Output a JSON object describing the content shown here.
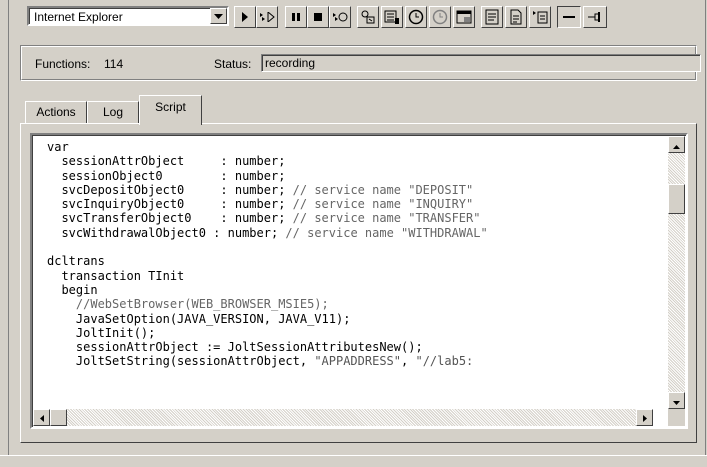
{
  "toolbar": {
    "browser_select_value": "Internet Explorer",
    "icons": [
      "play-icon",
      "step-play-icon",
      "pause-icon",
      "stop-icon",
      "record-icon",
      "wizard-icon",
      "options-icon",
      "timer-icon",
      "timer-stop-icon",
      "window-icon",
      "report-icon",
      "script-file-icon",
      "test-icon",
      "minimize-icon",
      "pin-icon"
    ]
  },
  "status": {
    "functions_label": "Functions:",
    "functions_count": "114",
    "status_label": "Status:",
    "status_value": "recording"
  },
  "tabs": [
    {
      "label": "Actions",
      "active": false
    },
    {
      "label": "Log",
      "active": false
    },
    {
      "label": "Script",
      "active": true
    }
  ],
  "script": {
    "lines": [
      [
        {
          "t": "var",
          "c": ""
        }
      ],
      [
        {
          "t": "  sessionAttrObject     : number;",
          "c": ""
        }
      ],
      [
        {
          "t": "  sessionObject0        : number;",
          "c": ""
        }
      ],
      [
        {
          "t": "  svcDepositObject0     : number; ",
          "c": ""
        },
        {
          "t": "// service name \"DEPOSIT\"",
          "c": "cm"
        }
      ],
      [
        {
          "t": "  svcInquiryObject0     : number; ",
          "c": ""
        },
        {
          "t": "// service name \"INQUIRY\"",
          "c": "cm"
        }
      ],
      [
        {
          "t": "  svcTransferObject0    : number; ",
          "c": ""
        },
        {
          "t": "// service name \"TRANSFER\"",
          "c": "cm"
        }
      ],
      [
        {
          "t": "  svcWithdrawalObject0 : number; ",
          "c": ""
        },
        {
          "t": "// service name \"WITHDRAWAL\"",
          "c": "cm"
        }
      ],
      [
        {
          "t": "",
          "c": ""
        }
      ],
      [
        {
          "t": "dcltrans",
          "c": ""
        }
      ],
      [
        {
          "t": "  transaction TInit",
          "c": ""
        }
      ],
      [
        {
          "t": "  begin",
          "c": ""
        }
      ],
      [
        {
          "t": "    //WebSetBrowser(WEB_BROWSER_MSIE5);",
          "c": "cm"
        }
      ],
      [
        {
          "t": "    JavaSetOption(JAVA_VERSION, JAVA_V11);",
          "c": ""
        }
      ],
      [
        {
          "t": "    JoltInit();",
          "c": ""
        }
      ],
      [
        {
          "t": "    sessionAttrObject := JoltSessionAttributesNew();",
          "c": ""
        }
      ],
      [
        {
          "t": "    JoltSetString(sessionAttrObject, ",
          "c": ""
        },
        {
          "t": "\"APPADDRESS\"",
          "c": "str"
        },
        {
          "t": ", ",
          "c": ""
        },
        {
          "t": "\"//lab5:",
          "c": "str"
        }
      ]
    ]
  }
}
